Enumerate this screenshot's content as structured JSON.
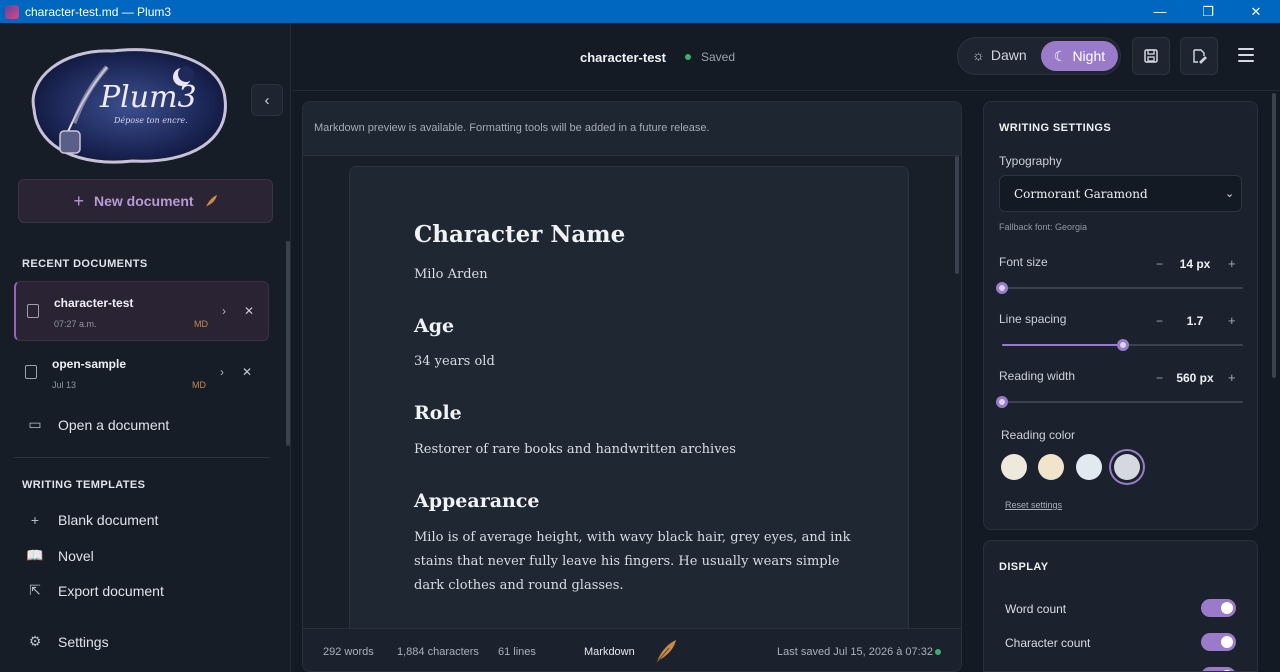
{
  "window": {
    "title": "character-test.md — Plum3",
    "controls": {
      "minimize": "—",
      "maximize": "❐",
      "close": "✕"
    }
  },
  "sidebar": {
    "logo": {
      "name": "Plum3",
      "tagline": "Dépose ton encre."
    },
    "new_document": "New document",
    "recent_title": "RECENT DOCUMENTS",
    "recent": [
      {
        "name": "character-test",
        "time": "07:27 a.m.",
        "ext": "MD",
        "active": true
      },
      {
        "name": "open-sample",
        "time": "Jul 13",
        "ext": "MD",
        "active": false
      }
    ],
    "open_document": "Open a document",
    "templates_title": "WRITING TEMPLATES",
    "templates": [
      {
        "label": "Blank document",
        "icon": "plus-icon"
      },
      {
        "label": "Novel",
        "icon": "book-icon"
      },
      {
        "label": "Export document",
        "icon": "export-icon"
      }
    ],
    "settings": "Settings"
  },
  "header": {
    "doc_title": "character-test",
    "status": "Saved",
    "theme": {
      "dawn": "Dawn",
      "night": "Night",
      "selected": "Night"
    },
    "icons": [
      "save-icon",
      "edit-document-icon",
      "menu-icon"
    ]
  },
  "editor": {
    "notice": "Markdown preview is available. Formatting tools will be added in a future release.",
    "content": {
      "h1": "Character Name",
      "p1": "Milo Arden",
      "h2": "Age",
      "p2": "34 years old",
      "h3": "Role",
      "p3": "Restorer of rare books and handwritten archives",
      "h4": "Appearance",
      "p4": "Milo is of average height, with wavy black hair, grey eyes, and ink stains that never fully leave his fingers. He usually wears simple dark clothes and round glasses."
    },
    "status": {
      "words": "292 words",
      "characters": "1,884 characters",
      "lines": "61 lines",
      "mode": "Markdown",
      "last_saved": "Last saved Jul 15, 2026 à 07:32"
    }
  },
  "settings": {
    "title": "WRITING SETTINGS",
    "typography_label": "Typography",
    "typography_value": "Cormorant Garamond",
    "fallback": "Fallback font: Georgia",
    "font_size": {
      "label": "Font size",
      "value": "14 px",
      "fraction": 0.0
    },
    "line_spacing": {
      "label": "Line spacing",
      "value": "1.7",
      "fraction": 0.5
    },
    "reading_width": {
      "label": "Reading width",
      "value": "560 px",
      "fraction": 0.0
    },
    "reading_color_label": "Reading color",
    "reading_colors": [
      "#efe8dc",
      "#f0e4cc",
      "#e1eaf0",
      "#d5d9df"
    ],
    "reading_color_selected": 3,
    "reset": "Reset settings",
    "stepper": {
      "minus": "−",
      "plus": "+"
    }
  },
  "display": {
    "title": "DISPLAY",
    "toggles": [
      {
        "label": "Word count",
        "on": true
      },
      {
        "label": "Character count",
        "on": true
      }
    ]
  },
  "colors": {
    "accent": "#9a7bc9",
    "saved": "#3fae6a",
    "background": "#141a23"
  }
}
